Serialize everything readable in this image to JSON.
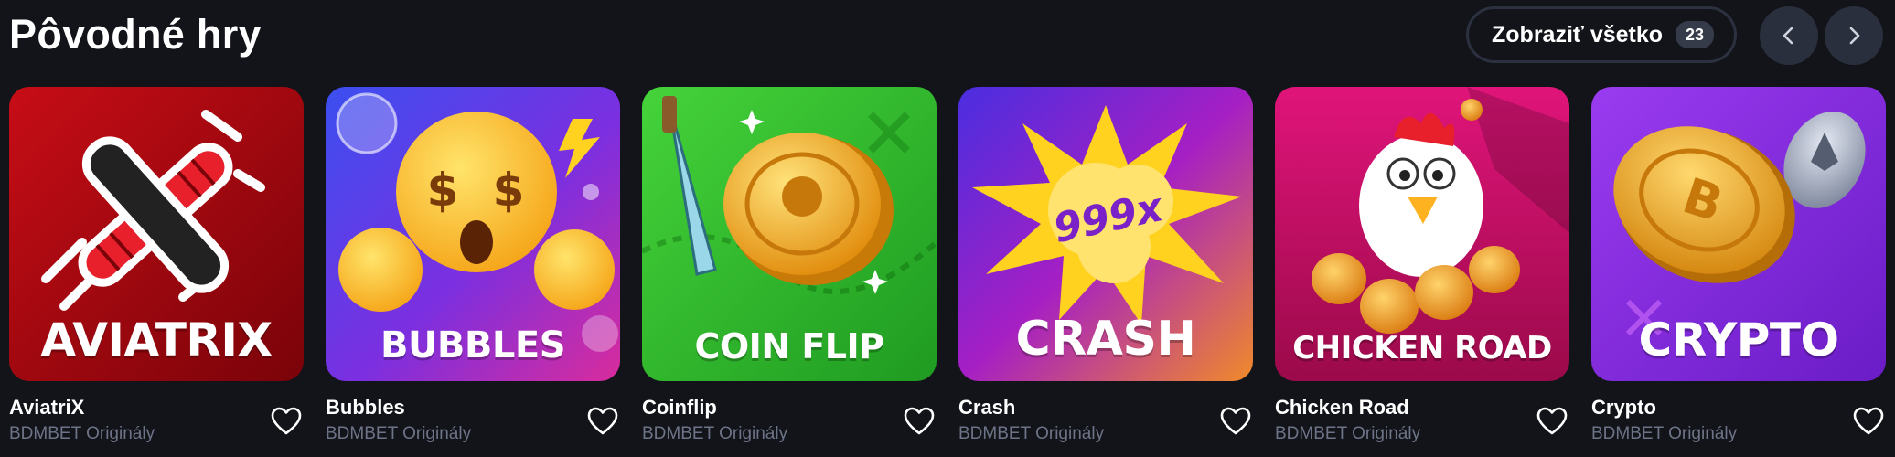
{
  "section": {
    "title": "Pôvodné hry",
    "view_all_label": "Zobraziť všetko",
    "view_all_count": "23"
  },
  "icons": {
    "prev": "chevron-left-icon",
    "next": "chevron-right-icon",
    "favorite": "heart-outline-icon"
  },
  "colors": {
    "background": "#12141a",
    "subtext": "#6e7487",
    "button_bg": "#2a2f3d"
  },
  "games": [
    {
      "name": "AviatriX",
      "provider": "BDMBET Originály",
      "art_label": "AVIATRIX"
    },
    {
      "name": "Bubbles",
      "provider": "BDMBET Originály",
      "art_label": "BUBBLES"
    },
    {
      "name": "Coinflip",
      "provider": "BDMBET Originály",
      "art_label": "COIN FLIP"
    },
    {
      "name": "Crash",
      "provider": "BDMBET Originály",
      "art_label": "CRASH",
      "art_multiplier": "999x"
    },
    {
      "name": "Chicken Road",
      "provider": "BDMBET Originály",
      "art_label": "CHICKEN ROAD"
    },
    {
      "name": "Crypto",
      "provider": "BDMBET Originály",
      "art_label": "CRYPTO"
    }
  ]
}
